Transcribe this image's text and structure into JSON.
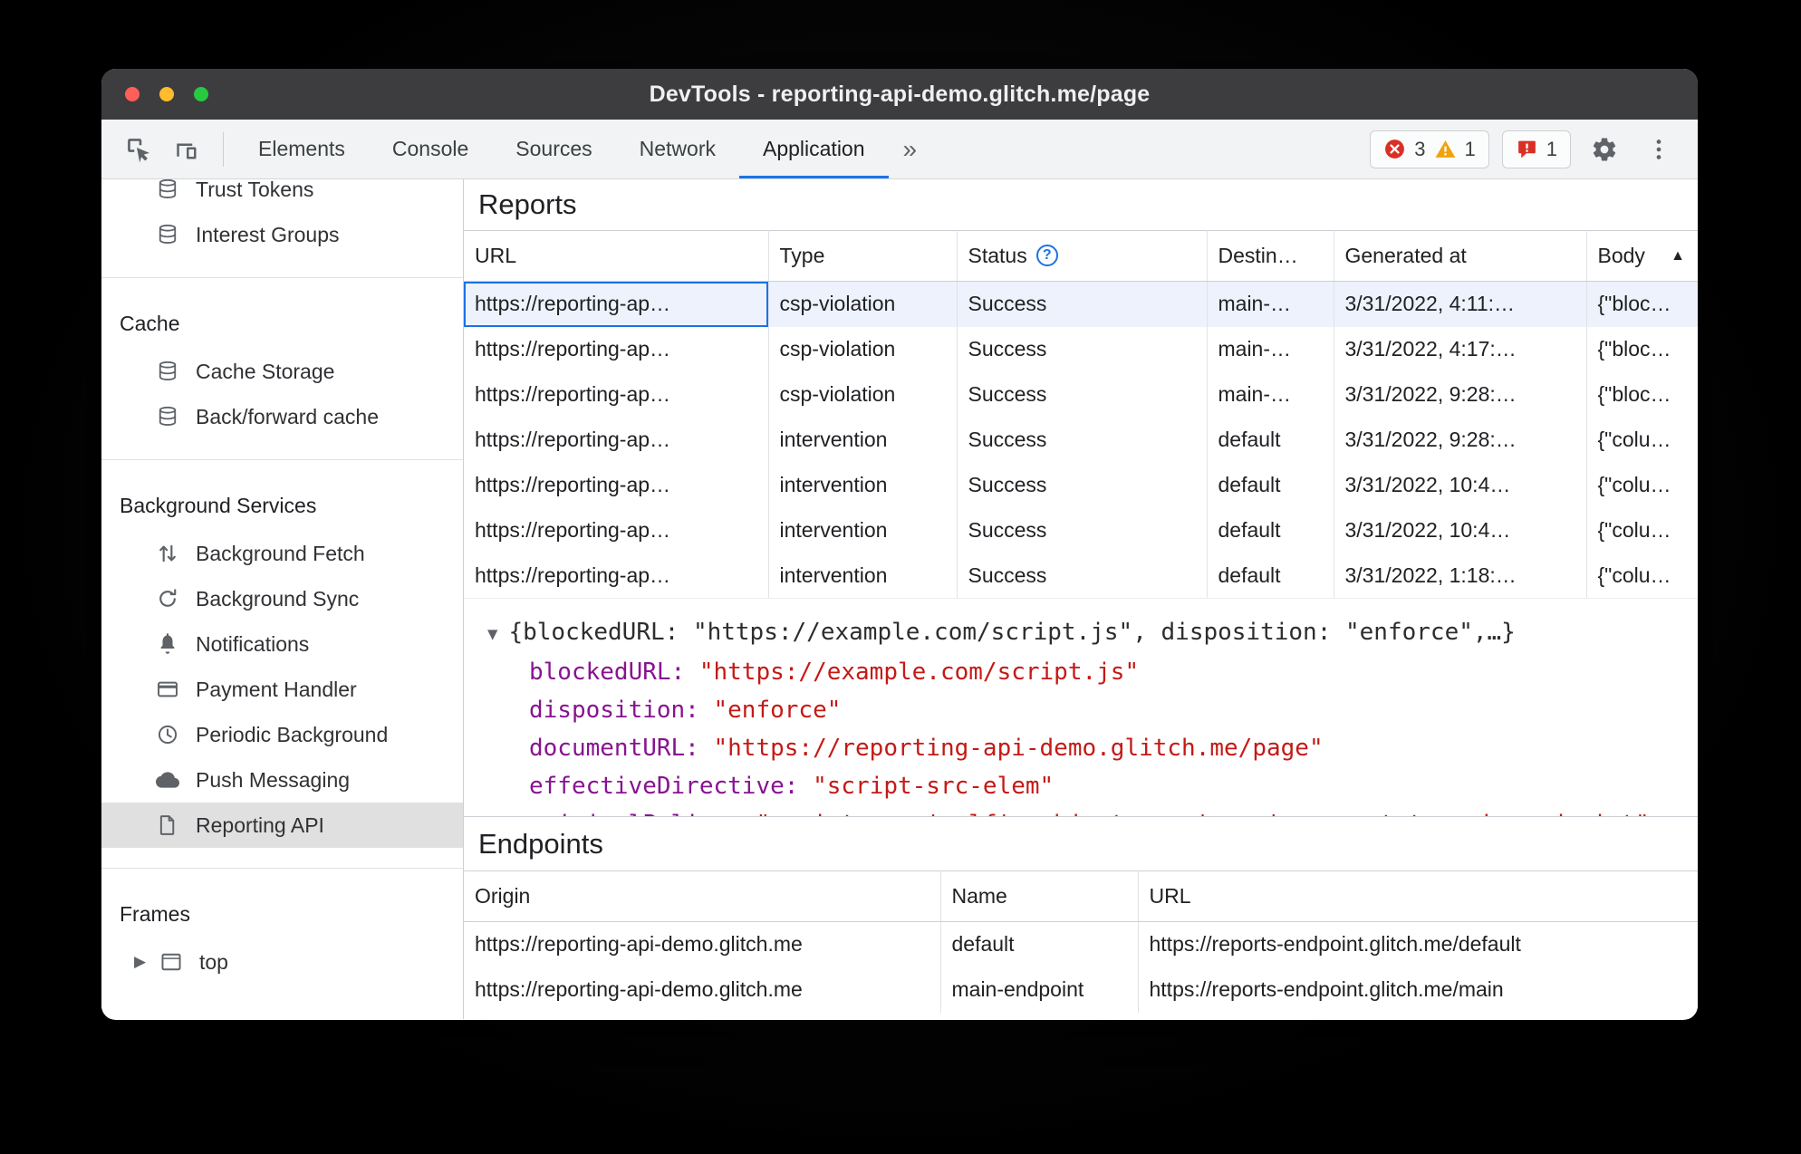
{
  "window": {
    "title": "DevTools - reporting-api-demo.glitch.me/page"
  },
  "colors": {
    "accent": "#1a73e8",
    "error_red": "#d93025",
    "warning_yellow": "#f0a30a",
    "issues_red": "#d93025",
    "key_purple": "#881391",
    "string_red": "#c41a16",
    "titlebar_bg": "#3d3d3f",
    "toolbar_bg": "#f1f3f4",
    "selected_row_bg": "#edf2fc",
    "sidebar_selected_bg": "#e0e0e0",
    "traffic_close": "#ff5f57",
    "traffic_minimize": "#febc2e",
    "traffic_zoom": "#28c840"
  },
  "toolbar": {
    "tabs": [
      {
        "label": "Elements",
        "active": false
      },
      {
        "label": "Console",
        "active": false
      },
      {
        "label": "Sources",
        "active": false
      },
      {
        "label": "Network",
        "active": false
      },
      {
        "label": "Application",
        "active": true
      }
    ],
    "more_tabs_glyph": "»",
    "badges": {
      "errors": "3",
      "warnings": "1",
      "issues": "1"
    }
  },
  "sidebar": {
    "groups": [
      {
        "header": null,
        "items": [
          {
            "label": "Trust Tokens",
            "icon": "database-icon"
          },
          {
            "label": "Interest Groups",
            "icon": "database-icon"
          }
        ]
      },
      {
        "header": "Cache",
        "items": [
          {
            "label": "Cache Storage",
            "icon": "database-icon"
          },
          {
            "label": "Back/forward cache",
            "icon": "database-icon"
          }
        ]
      },
      {
        "header": "Background Services",
        "items": [
          {
            "label": "Background Fetch",
            "icon": "background-fetch-icon"
          },
          {
            "label": "Background Sync",
            "icon": "background-sync-icon"
          },
          {
            "label": "Notifications",
            "icon": "bell-icon"
          },
          {
            "label": "Payment Handler",
            "icon": "payment-icon"
          },
          {
            "label": "Periodic Background",
            "icon": "clock-icon"
          },
          {
            "label": "Push Messaging",
            "icon": "cloud-icon"
          },
          {
            "label": "Reporting API",
            "icon": "file-icon",
            "selected": true
          }
        ]
      },
      {
        "header": "Frames",
        "items": [
          {
            "label": "top",
            "icon": "frame-icon",
            "expander": true
          }
        ]
      }
    ]
  },
  "reports": {
    "title": "Reports",
    "columns": [
      {
        "label": "URL"
      },
      {
        "label": "Type"
      },
      {
        "label": "Status",
        "help_icon": true
      },
      {
        "label": "Destin…"
      },
      {
        "label": "Generated at"
      },
      {
        "label": "Body",
        "sort": "asc"
      }
    ],
    "rows": [
      {
        "url": "https://reporting-ap…",
        "type": "csp-violation",
        "status": "Success",
        "destination": "main-…",
        "generated": "3/31/2022, 4:11:…",
        "body": "{\"bloc…",
        "selected": true
      },
      {
        "url": "https://reporting-ap…",
        "type": "csp-violation",
        "status": "Success",
        "destination": "main-…",
        "generated": "3/31/2022, 4:17:…",
        "body": "{\"bloc…",
        "selected": false
      },
      {
        "url": "https://reporting-ap…",
        "type": "csp-violation",
        "status": "Success",
        "destination": "main-…",
        "generated": "3/31/2022, 9:28:…",
        "body": "{\"bloc…",
        "selected": false
      },
      {
        "url": "https://reporting-ap…",
        "type": "intervention",
        "status": "Success",
        "destination": "default",
        "generated": "3/31/2022, 9:28:…",
        "body": "{\"colu…",
        "selected": false
      },
      {
        "url": "https://reporting-ap…",
        "type": "intervention",
        "status": "Success",
        "destination": "default",
        "generated": "3/31/2022, 10:4…",
        "body": "{\"colu…",
        "selected": false
      },
      {
        "url": "https://reporting-ap…",
        "type": "intervention",
        "status": "Success",
        "destination": "default",
        "generated": "3/31/2022, 10:4…",
        "body": "{\"colu…",
        "selected": false
      },
      {
        "url": "https://reporting-ap…",
        "type": "intervention",
        "status": "Success",
        "destination": "default",
        "generated": "3/31/2022, 1:18:…",
        "body": "{\"colu…",
        "selected": false
      }
    ]
  },
  "preview": {
    "expander_glyph": "▼",
    "summary": "{blockedURL: \"https://example.com/script.js\", disposition: \"enforce\",…}",
    "properties": [
      {
        "key": "blockedURL",
        "value": "\"https://example.com/script.js\"",
        "clipped": false
      },
      {
        "key": "disposition",
        "value": "\"enforce\"",
        "clipped": false
      },
      {
        "key": "documentURL",
        "value": "\"https://reporting-api-demo.glitch.me/page\"",
        "clipped": false
      },
      {
        "key": "effectiveDirective",
        "value": "\"script-src-elem\"",
        "clipped": false
      },
      {
        "key": "originalPolicy",
        "value": "\"script-src 'self'; object-src 'none'; report-to main-endpoint\"",
        "clipped": true
      }
    ]
  },
  "endpoints": {
    "title": "Endpoints",
    "columns": [
      "Origin",
      "Name",
      "URL"
    ],
    "rows": [
      {
        "origin": "https://reporting-api-demo.glitch.me",
        "name": "default",
        "url": "https://reports-endpoint.glitch.me/default"
      },
      {
        "origin": "https://reporting-api-demo.glitch.me",
        "name": "main-endpoint",
        "url": "https://reports-endpoint.glitch.me/main"
      }
    ]
  }
}
